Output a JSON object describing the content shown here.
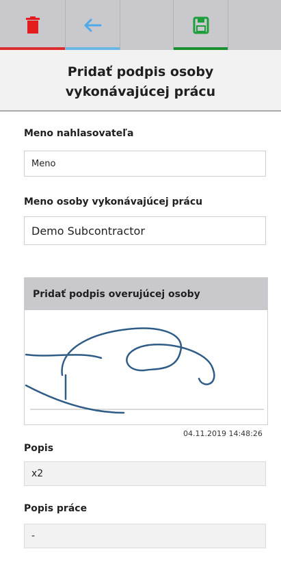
{
  "toolbar": {
    "buttons": [
      {
        "name": "delete",
        "icon": "trash-icon",
        "accent": "#dd2c2c"
      },
      {
        "name": "back",
        "icon": "arrow-left-icon",
        "accent": "#6ab7e4"
      },
      {
        "name": "empty",
        "icon": "",
        "accent": ""
      },
      {
        "name": "save",
        "icon": "floppy-disk-icon",
        "accent": "#1a8f2e"
      },
      {
        "name": "empty",
        "icon": "",
        "accent": ""
      }
    ]
  },
  "header": {
    "title": "Pridať podpis osoby vykonávajúcej prácu"
  },
  "form": {
    "reporter_label": "Meno nahlasovateľa",
    "reporter_value": "Meno",
    "worker_label": "Meno osoby vykonávajúcej prácu",
    "worker_value": "Demo Subcontractor",
    "signature_header": "Pridať podpis overujúcej osoby",
    "signature_timestamp": "04.11.2019 14:48:26",
    "description_label": "Popis",
    "description_value": "x2",
    "work_description_label": "Popis práce",
    "work_description_value": "-"
  }
}
